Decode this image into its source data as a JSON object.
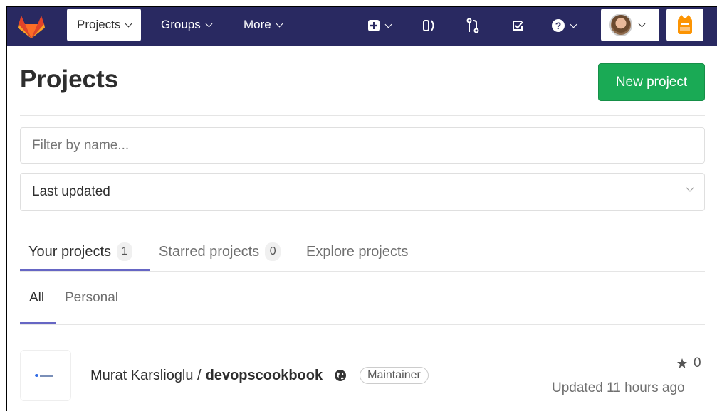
{
  "navbar": {
    "projects_label": "Projects",
    "groups_label": "Groups",
    "more_label": "More"
  },
  "page": {
    "title": "Projects",
    "new_project_label": "New project"
  },
  "filter": {
    "placeholder": "Filter by name..."
  },
  "sort": {
    "selected": "Last updated"
  },
  "tabs": [
    {
      "label": "Your projects",
      "count": "1"
    },
    {
      "label": "Starred projects",
      "count": "0"
    },
    {
      "label": "Explore projects"
    }
  ],
  "subtabs": [
    {
      "label": "All"
    },
    {
      "label": "Personal"
    }
  ],
  "project": {
    "namespace": "Murat Karslioglu /",
    "name": "devopscookbook",
    "role": "Maintainer",
    "stars": "0",
    "updated": "Updated 11 hours ago"
  },
  "colors": {
    "navbar": "#292961",
    "primary_button": "#1aaa55",
    "active_tab": "#6666c4"
  }
}
